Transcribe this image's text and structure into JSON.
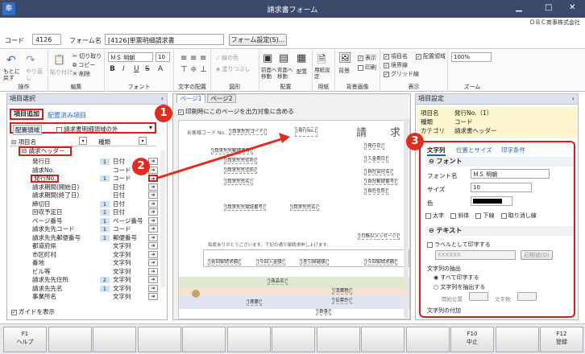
{
  "window": {
    "title": "請求書フォーム",
    "company": "ＯＢＣ商事株式会社",
    "logo": "奉"
  },
  "header": {
    "code_label": "コード",
    "code_value": "4126",
    "form_name_label": "フォーム名",
    "form_name_value": "[4126]単票明細請求書",
    "settings_button": "フォーム設定(S)..."
  },
  "ribbon": {
    "groups": [
      "操作",
      "編集",
      "フォント",
      "文字の配置",
      "図形",
      "配置",
      "用紙",
      "背景画像",
      "表示",
      "ズーム"
    ],
    "undo": "もとに戻す",
    "redo": "やり直し",
    "paste": "貼り付け",
    "cut": "切り取り",
    "copy": "コピー",
    "delete": "削除",
    "font_name": "ＭＳ 明朝",
    "font_size": "10",
    "line_color": "線の色",
    "fill_color": "塗りつぶし",
    "bring_front": "前面へ移動",
    "send_back": "背面へ移動",
    "arrange": "配置",
    "paper_settings": "用紙設定",
    "background": "背景",
    "bg_show": "表示",
    "bg_print": "印刷",
    "view_item_name": "項目名",
    "view_border": "境界線",
    "view_grid": "グリッド線",
    "view_area": "配置領域",
    "zoom": "100%"
  },
  "left": {
    "panel_title": "項目選択",
    "tab_add": "項目追加",
    "tab_placed": "配置済み項目",
    "area_label": "配置領域",
    "area_value": "請求書明細領域の外",
    "col_name": "項目名",
    "col_kind": "種類",
    "group": "請求ヘッダー",
    "items": [
      {
        "name": "発行日",
        "num": "1",
        "kind": "日付"
      },
      {
        "name": "請求No.",
        "num": "",
        "kind": "コード"
      },
      {
        "name": "発行No.",
        "num": "1",
        "kind": "コード"
      },
      {
        "name": "請求期間(開始日)",
        "num": "",
        "kind": "日付"
      },
      {
        "name": "請求期間(終了日)",
        "num": "",
        "kind": "日付"
      },
      {
        "name": "締切日",
        "num": "1",
        "kind": "日付"
      },
      {
        "name": "回収予定日",
        "num": "1",
        "kind": "日付"
      },
      {
        "name": "ページ番号",
        "num": "1",
        "kind": "ページ番号"
      },
      {
        "name": "請求先先コード",
        "num": "1",
        "kind": "コード"
      },
      {
        "name": "請求先先郵便番号",
        "num": "1",
        "kind": "郵便番号"
      },
      {
        "name": "都道府県",
        "num": "",
        "kind": "文字列"
      },
      {
        "name": "市区町村",
        "num": "",
        "kind": "文字列"
      },
      {
        "name": "番地",
        "num": "",
        "kind": "文字列"
      },
      {
        "name": "ビル等",
        "num": "",
        "kind": "文字列"
      },
      {
        "name": "請求先先住所",
        "num": "2",
        "kind": "文字列"
      },
      {
        "name": "請求先先名",
        "num": "1",
        "kind": "文字列"
      },
      {
        "name": "事業所名",
        "num": "",
        "kind": "文字列"
      }
    ],
    "guide_checkbox": "ガイドを表示"
  },
  "middle": {
    "tabs": [
      "ページ1",
      "ページ2"
    ],
    "checkbox": "印刷時にこのページを出力対象に含める",
    "sheet": {
      "title_part": "請　求",
      "customer_code": "お客様コード No.",
      "fields": [
        "[請求先先コード]",
        "[発行No.]",
        "[請求先先郵便番号]",
        "[発行日]",
        "[請求先先住所]",
        "[請求先先住所]",
        "[請求先先名]",
        "[請求先先電話番号]",
        "[請求先先名]",
        "[入金期日]",
        "[自社会社名]",
        "[自社郵便番号]",
        "[自社住所]",
        "[付帳以メッセージ]",
        "[前回御請求額]",
        "[今回入金額]",
        "[差引繰越額]",
        "[今回御請求額]",
        "[商品名]",
        "[消費税]",
        "[伝票計]",
        "[摘要]",
        "[数量]"
      ],
      "message": "毎度ありがとうございます。下記の通り御請求申し上げます。"
    }
  },
  "right": {
    "panel_title": "項目設定",
    "item_label": "項目名",
    "item_value": "発行No.（1）",
    "kind_label": "種類",
    "kind_value": "コード",
    "category_label": "カテゴリ",
    "category_value": "請求書ヘッダー",
    "tabs": [
      "文字列",
      "位置とサイズ",
      "印字条件"
    ],
    "font_section": "フォント",
    "font_name_label": "フォント名",
    "font_name_value": "ＭＳ 明朝",
    "size_label": "サイズ",
    "size_value": "10",
    "color_label": "色",
    "styles": [
      "太字",
      "斜体",
      "下線",
      "取り消し線"
    ],
    "text_section": "テキスト",
    "label_print": "ラベルとして印字する",
    "label_value": "XXXXXX",
    "initial_button": "初期値(D)",
    "extract_label": "文字列の抽出",
    "radio_all": "すべて印字する",
    "radio_extract": "文字列を抽出する",
    "start_pos": "開始位置",
    "char_count": "文字数",
    "append_label": "文字列の付加"
  },
  "fkeys": [
    {
      "key": "F1",
      "label": "ヘルプ"
    },
    {
      "key": "",
      "label": ""
    },
    {
      "key": "",
      "label": ""
    },
    {
      "key": "",
      "label": ""
    },
    {
      "key": "",
      "label": ""
    },
    {
      "key": "",
      "label": ""
    },
    {
      "key": "",
      "label": ""
    },
    {
      "key": "",
      "label": ""
    },
    {
      "key": "",
      "label": ""
    },
    {
      "key": "",
      "label": ""
    },
    {
      "key": "F10",
      "label": "中止"
    },
    {
      "key": "",
      "label": ""
    },
    {
      "key": "F12",
      "label": "登録"
    }
  ],
  "callouts": [
    "1",
    "2",
    "3"
  ],
  "colors": {
    "accent_red": "#e01919",
    "titlebar": "#3b4a6b",
    "callout": "#e42b1f"
  }
}
